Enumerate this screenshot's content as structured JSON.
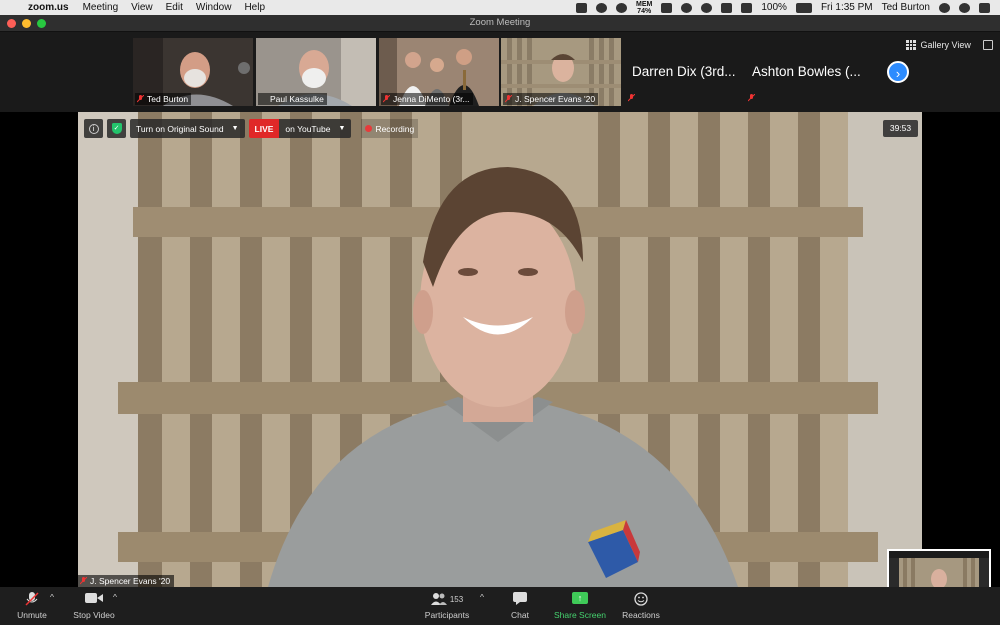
{
  "menubar": {
    "app": "zoom.us",
    "items": [
      "Meeting",
      "View",
      "Edit",
      "Window",
      "Help"
    ],
    "mem_label": "MEM",
    "mem_value": "74%",
    "battery": "100%",
    "clock": "Fri 1:35 PM",
    "user": "Ted Burton"
  },
  "window": {
    "title": "Zoom Meeting"
  },
  "gallery": {
    "view_label": "Gallery View",
    "tiles": [
      {
        "name": "Ted Burton"
      },
      {
        "name": "Paul Kassulke"
      },
      {
        "name": "Jenna DiMento (3r..."
      },
      {
        "name": "J. Spencer Evans '20"
      },
      {
        "name": "Darren Dix (3rd..."
      },
      {
        "name": "Ashton Bowles (..."
      }
    ]
  },
  "stage": {
    "original_sound": "Turn on Original Sound",
    "live_badge": "LIVE",
    "live_target": "on YouTube",
    "recording": "Recording",
    "timer": "39:53",
    "speaker": "J. Spencer Evans '20"
  },
  "toolbar": {
    "unmute": "Unmute",
    "stop_video": "Stop Video",
    "participants": "Participants",
    "participants_count": "153",
    "chat": "Chat",
    "share_screen": "Share Screen",
    "reactions": "Reactions"
  },
  "colors": {
    "accent_blue": "#2d8cff",
    "live_red": "#e02828",
    "share_green": "#3fca58",
    "active_speaker": "#d8d45a"
  }
}
